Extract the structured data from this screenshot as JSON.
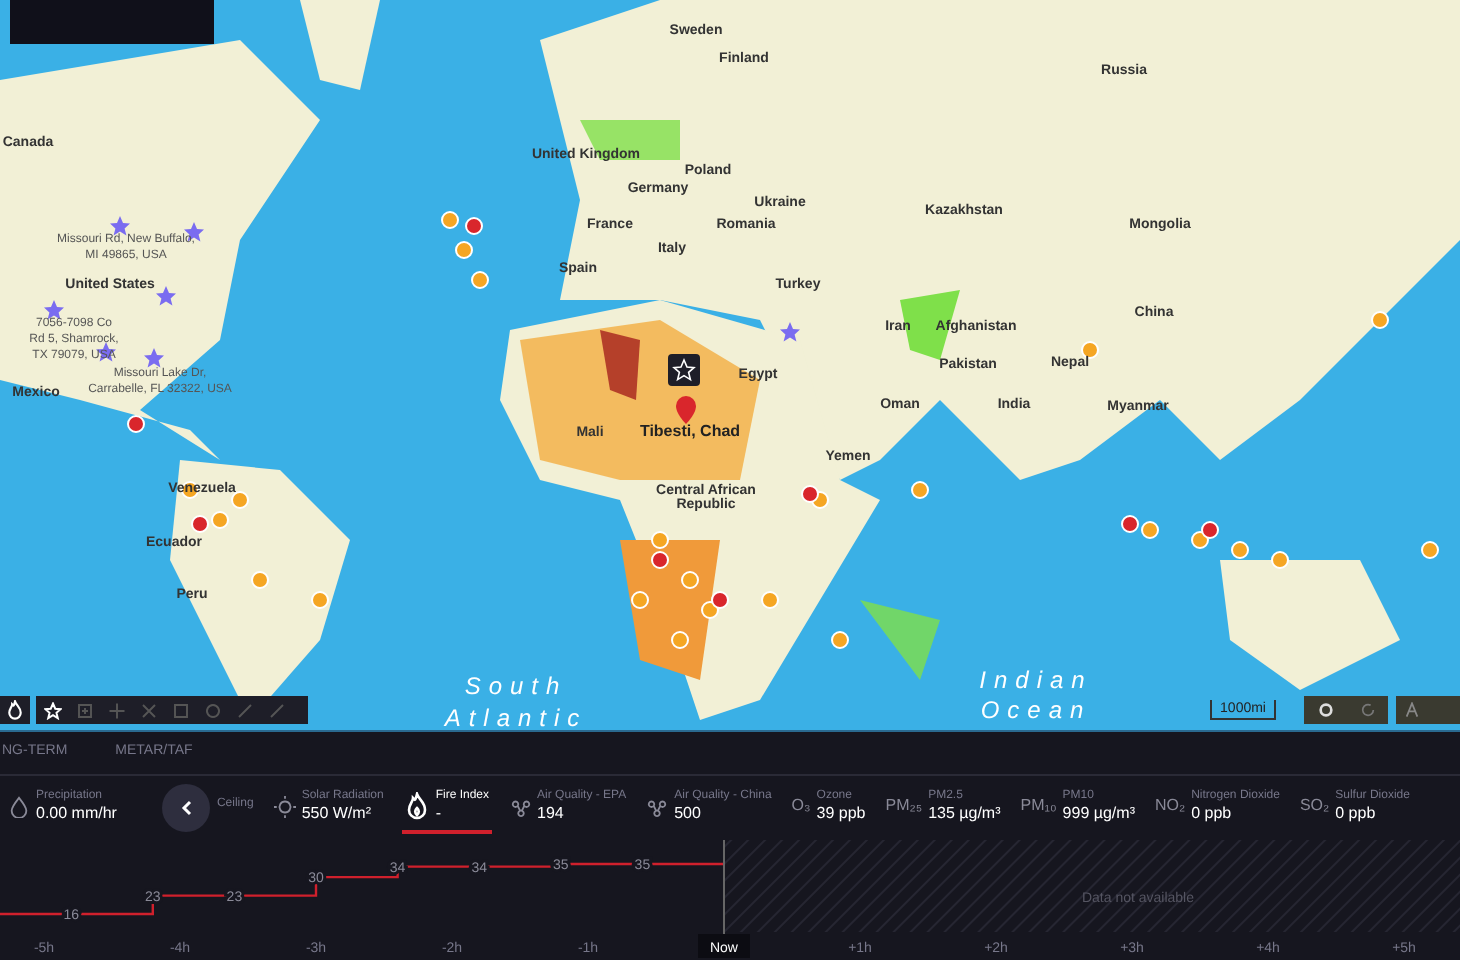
{
  "map": {
    "labels": [
      {
        "text": "Sweden",
        "kind": "country"
      },
      {
        "text": "Finland",
        "kind": "country"
      },
      {
        "text": "Russia",
        "kind": "country"
      },
      {
        "text": "Canada",
        "kind": "country"
      },
      {
        "text": "United Kingdom",
        "kind": "country"
      },
      {
        "text": "Poland",
        "kind": "country"
      },
      {
        "text": "Germany",
        "kind": "country"
      },
      {
        "text": "Ukraine",
        "kind": "country"
      },
      {
        "text": "Kazakhstan",
        "kind": "country"
      },
      {
        "text": "France",
        "kind": "country"
      },
      {
        "text": "Romania",
        "kind": "country"
      },
      {
        "text": "Mongolia",
        "kind": "country"
      },
      {
        "text": "Missouri Rd, New Buffalo,",
        "kind": "address"
      },
      {
        "text": "Italy",
        "kind": "country"
      },
      {
        "text": "MI 49865, USA",
        "kind": "address"
      },
      {
        "text": "Spain",
        "kind": "country"
      },
      {
        "text": "United States",
        "kind": "country"
      },
      {
        "text": "Turkey",
        "kind": "country"
      },
      {
        "text": "China",
        "kind": "country"
      },
      {
        "text": "7056-7098 Co",
        "kind": "address"
      },
      {
        "text": "Iran",
        "kind": "country"
      },
      {
        "text": "Afghanistan",
        "kind": "country"
      },
      {
        "text": "Rd 5, Shamrock,",
        "kind": "address"
      },
      {
        "text": "TX 79079, USA",
        "kind": "address"
      },
      {
        "text": "Pakistan",
        "kind": "country"
      },
      {
        "text": "Nepal",
        "kind": "country"
      },
      {
        "text": "Missouri Lake Dr,",
        "kind": "address"
      },
      {
        "text": "Egypt",
        "kind": "country"
      },
      {
        "text": "Mexico",
        "kind": "country"
      },
      {
        "text": "Carrabelle, FL 32322, USA",
        "kind": "address"
      },
      {
        "text": "Oman",
        "kind": "country"
      },
      {
        "text": "India",
        "kind": "country"
      },
      {
        "text": "Myanmar",
        "kind": "country"
      },
      {
        "text": "Mali",
        "kind": "country"
      },
      {
        "text": "Tibesti, Chad",
        "kind": "place"
      },
      {
        "text": "Yemen",
        "kind": "country"
      },
      {
        "text": "Venezuela",
        "kind": "country"
      },
      {
        "text": "Central African",
        "kind": "country"
      },
      {
        "text": "Republic",
        "kind": "country"
      },
      {
        "text": "Ecuador",
        "kind": "country"
      },
      {
        "text": "Peru",
        "kind": "country"
      },
      {
        "text": "South",
        "kind": "ocean"
      },
      {
        "text": "Indian",
        "kind": "ocean"
      },
      {
        "text": "Atlantic",
        "kind": "ocean"
      },
      {
        "text": "Ocean",
        "kind": "ocean"
      }
    ],
    "scale": "1000mi"
  },
  "tabs": [
    {
      "label": "NG-TERM",
      "selected": false
    },
    {
      "label": "METAR/TAF",
      "selected": false
    }
  ],
  "metrics": [
    {
      "kind": "drop",
      "label": "Precipitation",
      "value": "0.00 mm/hr",
      "selected": false
    },
    {
      "kind": "plain",
      "label": "Ceiling",
      "selected": false
    },
    {
      "kind": "sun",
      "label": "Solar Radiation",
      "value": "550 W/m²",
      "selected": false
    },
    {
      "kind": "fire",
      "label": "Fire Index",
      "value": "-",
      "selected": true
    },
    {
      "kind": "air",
      "label": "Air Quality - EPA",
      "value": "194",
      "selected": false
    },
    {
      "kind": "air",
      "label": "Air Quality - China",
      "value": "500",
      "selected": false
    },
    {
      "kind": "text",
      "symbol": "O₃",
      "label": "Ozone",
      "value": "39 ppb",
      "selected": false
    },
    {
      "kind": "text",
      "symbol": "PM₂₅",
      "label": "PM2.5",
      "value": "135 µg/m³",
      "selected": false
    },
    {
      "kind": "text",
      "symbol": "PM₁₀",
      "label": "PM10",
      "value": "999 µg/m³",
      "selected": false
    },
    {
      "kind": "text",
      "symbol": "NO₂",
      "label": "Nitrogen Dioxide",
      "value": "0 ppb",
      "selected": false
    },
    {
      "kind": "text",
      "symbol": "SO₂",
      "label": "Sulfur Dioxide",
      "value": "0 ppb",
      "selected": false
    }
  ],
  "fire_index_graph": {
    "readings": [
      "16",
      "23",
      "23",
      "30",
      "34",
      "34",
      "35",
      "35"
    ],
    "note": "Data not available"
  },
  "timeline": [
    {
      "kind": "tick",
      "label": "-5h"
    },
    {
      "kind": "tick",
      "label": "-4h"
    },
    {
      "kind": "tick",
      "label": "-3h"
    },
    {
      "kind": "tick",
      "label": "-2h"
    },
    {
      "kind": "tick",
      "label": "-1h"
    },
    {
      "kind": "now",
      "label": "Now"
    },
    {
      "kind": "tick",
      "label": "+1h"
    },
    {
      "kind": "tick",
      "label": "+2h"
    },
    {
      "kind": "tick",
      "label": "+3h"
    },
    {
      "kind": "tick",
      "label": "+4h"
    },
    {
      "kind": "tick",
      "label": "+5h"
    }
  ]
}
